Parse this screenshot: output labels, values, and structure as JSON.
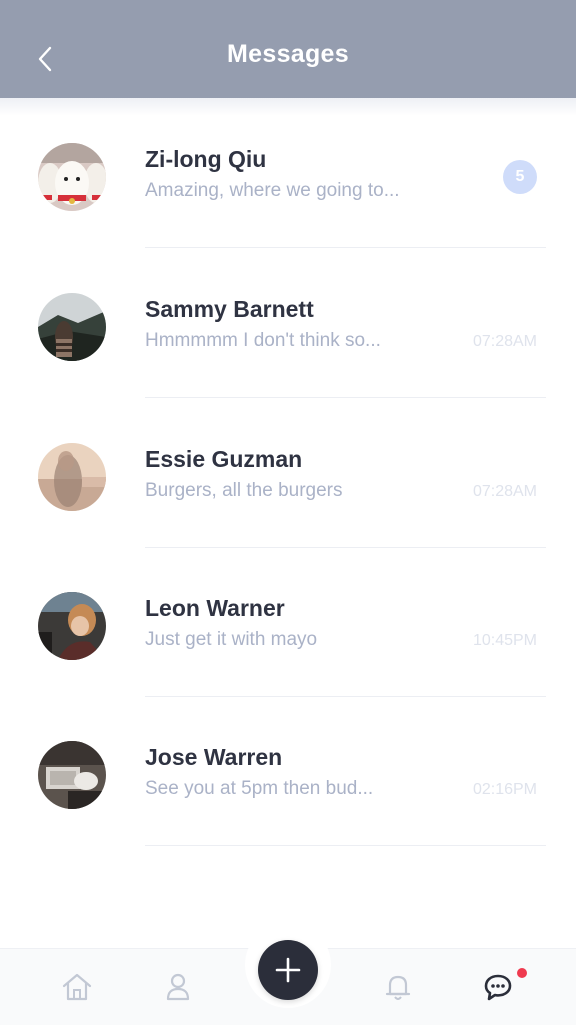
{
  "header": {
    "title": "Messages",
    "back_icon": "chevron-left-icon",
    "background": "#959daf"
  },
  "conversations": [
    {
      "name": "Zi-long Qiu",
      "preview": "Amazing, where we going to...",
      "time": "",
      "unread": "5"
    },
    {
      "name": "Sammy Barnett",
      "preview": "Hmmmmm I don't think so...",
      "time": "07:28AM",
      "unread": ""
    },
    {
      "name": "Essie Guzman",
      "preview": "Burgers, all the burgers",
      "time": "07:28AM",
      "unread": ""
    },
    {
      "name": "Leon Warner",
      "preview": "Just get it with mayo",
      "time": "10:45PM",
      "unread": ""
    },
    {
      "name": "Jose Warren",
      "preview": "See you at 5pm then bud...",
      "time": "02:16PM",
      "unread": ""
    }
  ],
  "tabbar": {
    "tabs": [
      "home-icon",
      "profile-icon",
      "add-icon",
      "bell-icon",
      "chat-icon"
    ],
    "active_tab": "chat-icon",
    "notification_dot_color": "#ef3a4f"
  }
}
